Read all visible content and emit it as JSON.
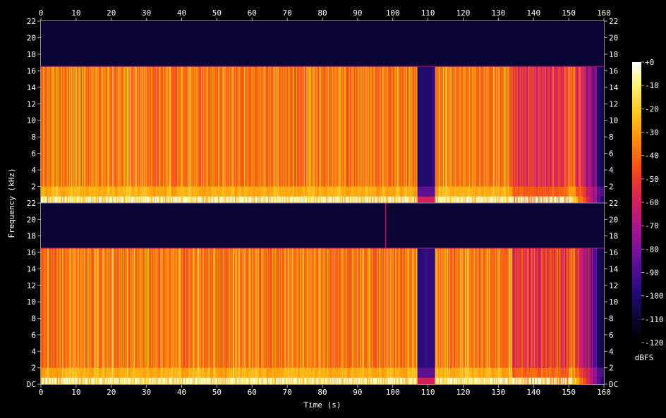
{
  "chart_data": {
    "type": "heatmap",
    "xlabel": "Time (s)",
    "ylabel": "Frequency (kHz)",
    "xlim": [
      0,
      160
    ],
    "ylim": [
      0,
      22
    ],
    "x_ticks": [
      "0",
      "10",
      "20",
      "30",
      "40",
      "50",
      "60",
      "70",
      "80",
      "90",
      "100",
      "110",
      "120",
      "130",
      "140",
      "150",
      "160"
    ],
    "y_ticks": [
      "DC",
      "2",
      "4",
      "6",
      "8",
      "10",
      "12",
      "14",
      "16",
      "18",
      "20",
      "22"
    ],
    "channels": 2,
    "upper_cutoff_khz": 16.5,
    "quiet_interval_s": [
      107,
      112
    ],
    "colorbar": {
      "label": "dBFS",
      "range": [
        -120,
        0
      ],
      "ticks": [
        "+0",
        "-10",
        "-20",
        "-30",
        "-40",
        "-50",
        "-60",
        "-70",
        "-80",
        "-90",
        "-100",
        "-110",
        "-120"
      ],
      "colors": [
        "#000000",
        "#0c0530",
        "#1f0a6e",
        "#4b0f8e",
        "#7a1496",
        "#a8168c",
        "#d21f5e",
        "#ee3a2c",
        "#fa6a10",
        "#fe9e0b",
        "#fece24",
        "#fff27a",
        "#ffffff"
      ]
    }
  }
}
